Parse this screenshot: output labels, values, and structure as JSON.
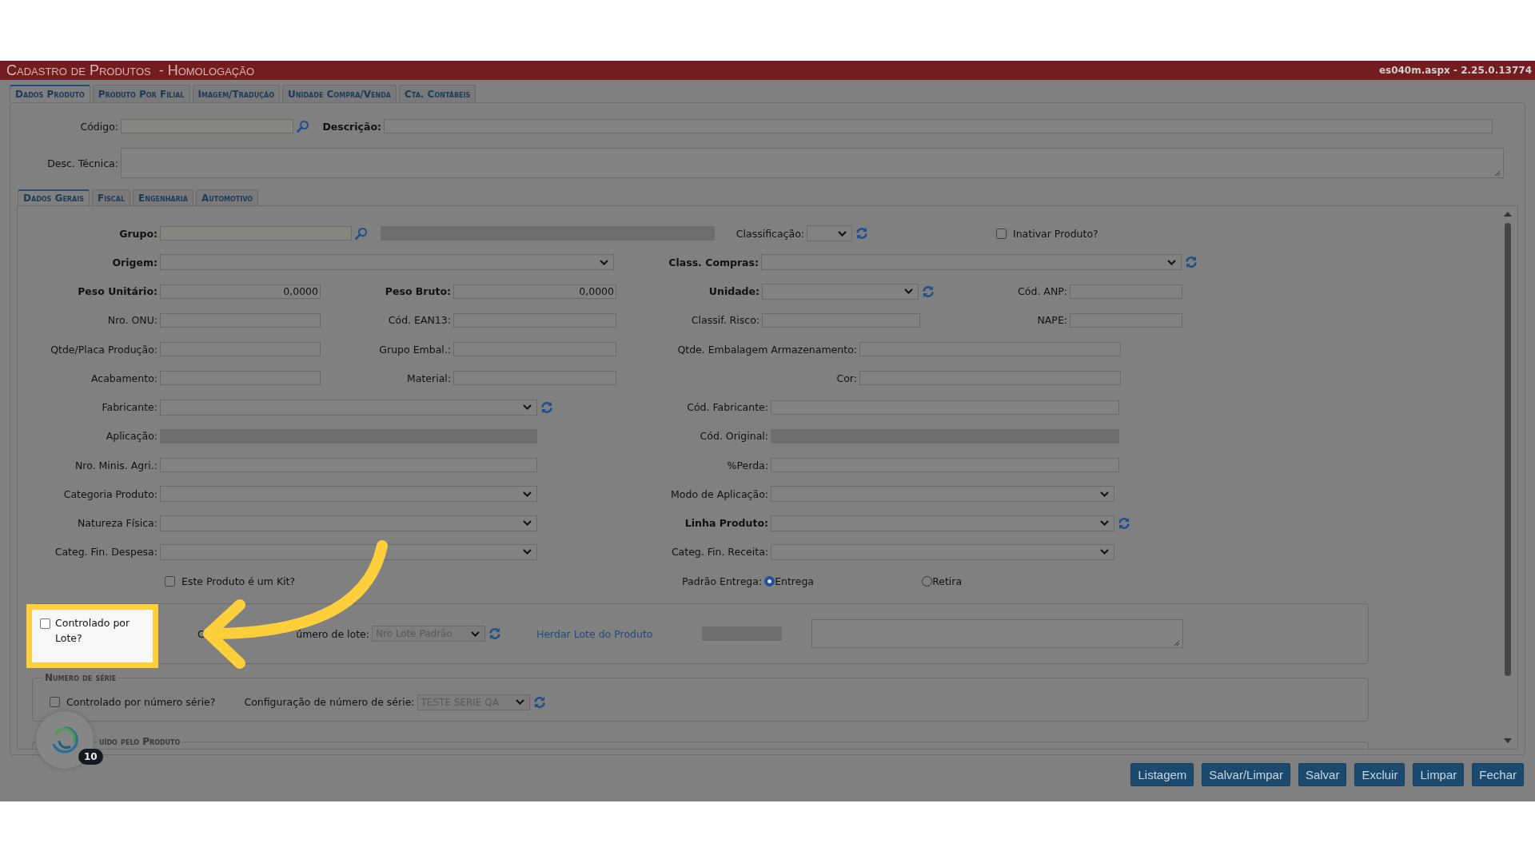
{
  "header": {
    "title": "Cadastro de Produtos  - Homologação",
    "version": "es040m.aspx - 2.25.0.13774"
  },
  "tabs": [
    {
      "label": "Dados Produto",
      "selected": true
    },
    {
      "label": "Produto Por Filial",
      "selected": false
    },
    {
      "label": "Imagem/Tradução",
      "selected": false
    },
    {
      "label": "Unidade Compra/Venda",
      "selected": false
    },
    {
      "label": "Cta. Contábeis",
      "selected": false
    }
  ],
  "codigo": {
    "label": "Código:"
  },
  "descricao": {
    "label": "Descrição:"
  },
  "desc_tecnica": {
    "label": "Desc. Técnica:"
  },
  "subtabs": [
    {
      "label": "Dados Gerais",
      "selected": true
    },
    {
      "label": "Fiscal",
      "selected": false
    },
    {
      "label": "Engenharia",
      "selected": false
    },
    {
      "label": "Automotivo",
      "selected": false
    }
  ],
  "form_rows": [
    {
      "fields": [
        {
          "kind": "lookup",
          "label": "Grupo:",
          "bold": true,
          "search_button": true
        },
        {
          "kind": "readonly"
        },
        {
          "kind": "select",
          "label": "Classificação:",
          "bold": false,
          "refresh_button": true
        },
        {
          "kind": "checkbox",
          "label": "Inativar Produto?",
          "checked": false
        }
      ]
    },
    {
      "fields": [
        {
          "kind": "select",
          "label": "Origem:",
          "bold": true
        },
        {
          "kind": "select",
          "label": "Class. Compras:",
          "bold": true,
          "refresh_button": true
        }
      ]
    },
    {
      "fields": [
        {
          "kind": "input",
          "label": "Peso Unitário:",
          "bold": true,
          "value": "0,0000"
        },
        {
          "kind": "input",
          "label": "Peso Bruto:",
          "bold": true,
          "value": "0,0000"
        },
        {
          "kind": "select",
          "label": "Unidade:",
          "bold": true,
          "refresh_button": true
        },
        {
          "kind": "input",
          "label": "Cód. ANP:",
          "bold": false
        }
      ]
    },
    {
      "fields": [
        {
          "kind": "input",
          "label": "Nro. ONU:",
          "bold": false
        },
        {
          "kind": "input",
          "label": "Cód. EAN13:",
          "bold": false
        },
        {
          "kind": "input",
          "label": "Classif. Risco:",
          "bold": false
        },
        {
          "kind": "input",
          "label": "NAPE:",
          "bold": false
        }
      ]
    },
    {
      "fields": [
        {
          "kind": "input",
          "label": "Qtde/Placa Produção:",
          "bold": false
        },
        {
          "kind": "input",
          "label": "Grupo Embal.:",
          "bold": false
        },
        {
          "kind": "input",
          "label": "Qtde. Embalagem Armazenamento:",
          "bold": false
        }
      ]
    },
    {
      "fields": [
        {
          "kind": "input",
          "label": "Acabamento:",
          "bold": false
        },
        {
          "kind": "input",
          "label": "Material:",
          "bold": false
        },
        {
          "kind": "input",
          "label": "Cor:",
          "bold": false
        }
      ]
    },
    {
      "fields": [
        {
          "kind": "select",
          "label": "Fabricante:",
          "bold": false,
          "refresh_button": true
        },
        {
          "kind": "input",
          "label": "Cód. Fabricante:",
          "bold": false
        }
      ]
    },
    {
      "fields": [
        {
          "kind": "readonly",
          "label": "Aplicação:",
          "bold": false
        },
        {
          "kind": "readonly",
          "label": "Cód. Original:",
          "bold": false
        }
      ]
    },
    {
      "fields": [
        {
          "kind": "input",
          "label": "Nro. Minis. Agri.:",
          "bold": false
        },
        {
          "kind": "input",
          "label": "%Perda:",
          "bold": false
        }
      ]
    },
    {
      "fields": [
        {
          "kind": "select",
          "label": "Categoria Produto:",
          "bold": false
        },
        {
          "kind": "select",
          "label": "Modo de Aplicação:",
          "bold": false
        }
      ]
    },
    {
      "fields": [
        {
          "kind": "select",
          "label": "Natureza Física:",
          "bold": false
        },
        {
          "kind": "select",
          "label": "Linha Produto:",
          "bold": true,
          "refresh_button": true
        }
      ]
    },
    {
      "fields": [
        {
          "kind": "select",
          "label": "Categ. Fin. Despesa:",
          "bold": false
        },
        {
          "kind": "select",
          "label": "Categ. Fin. Receita:",
          "bold": false
        }
      ]
    }
  ],
  "kit": {
    "label": "Este Produto é um Kit?",
    "checked": false
  },
  "padrao_entrega": {
    "label": "Padrão Entrega:",
    "options": [
      {
        "label": "Entrega",
        "selected": true
      },
      {
        "label": "Retira",
        "selected": false
      }
    ]
  },
  "lote": {
    "checkbox": {
      "label": "Controlado por Lote?",
      "checked": false
    },
    "number_label_start": "C",
    "number_label_end": "úmero de lote:",
    "select_value": "Nro Lote Padrão",
    "link": "Herdar Lote do Produto"
  },
  "serie": {
    "legend": "Numero de série",
    "checkbox": {
      "label": "Controlado por número série?",
      "checked": false
    },
    "config_label": "Configuração de número de série:",
    "select_value": "TESTE SERIE QA"
  },
  "third_section": {
    "legend": "uído pelo Produto"
  },
  "assistant_badge": {
    "count": "10"
  },
  "buttons": [
    "Listagem",
    "Salvar/Limpar",
    "Salvar",
    "Excluir",
    "Limpar",
    "Fechar"
  ]
}
